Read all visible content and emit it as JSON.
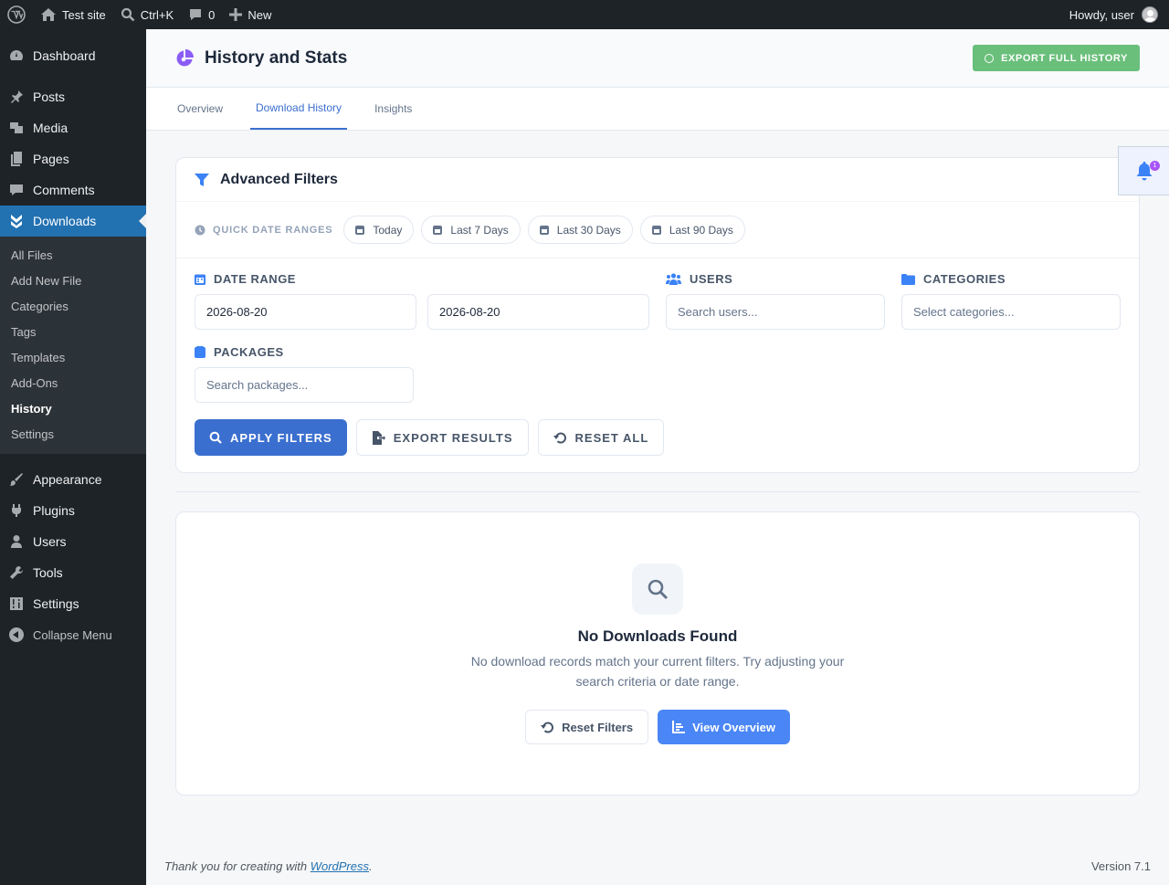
{
  "adminbar": {
    "site_name": "Test site",
    "search_shortcut": "Ctrl+K",
    "comments_count": "0",
    "new_label": "New",
    "greeting": "Howdy, user"
  },
  "sidebar": {
    "items_top": [
      {
        "label": "Dashboard",
        "icon": "dashboard-icon"
      }
    ],
    "items_mid": [
      {
        "label": "Posts",
        "icon": "pin-icon"
      },
      {
        "label": "Media",
        "icon": "media-icon"
      },
      {
        "label": "Pages",
        "icon": "pages-icon"
      },
      {
        "label": "Comments",
        "icon": "comment-icon"
      }
    ],
    "active": {
      "label": "Downloads",
      "icon": "downloads-icon"
    },
    "submenu": [
      "All Files",
      "Add New File",
      "Categories",
      "Tags",
      "Templates",
      "Add-Ons",
      "History",
      "Settings"
    ],
    "items_bottom": [
      {
        "label": "Appearance",
        "icon": "brush-icon"
      },
      {
        "label": "Plugins",
        "icon": "plugin-icon"
      },
      {
        "label": "Users",
        "icon": "user-icon"
      },
      {
        "label": "Tools",
        "icon": "wrench-icon"
      },
      {
        "label": "Settings",
        "icon": "settings-icon"
      }
    ],
    "collapse_label": "Collapse Menu"
  },
  "header": {
    "title": "History and Stats",
    "export_label": "EXPORT FULL HISTORY",
    "accent": "#8b5cf6"
  },
  "tabs": [
    "Overview",
    "Download History",
    "Insights"
  ],
  "filters": {
    "title": "Advanced Filters",
    "quick_label": "QUICK DATE RANGES",
    "quick_ranges": [
      "Today",
      "Last 7 Days",
      "Last 30 Days",
      "Last 90 Days"
    ],
    "date_range_label": "DATE RANGE",
    "date_from": "2026-08-20",
    "date_to": "2026-08-20",
    "users_label": "USERS",
    "users_placeholder": "Search users...",
    "categories_label": "CATEGORIES",
    "categories_placeholder": "Select categories...",
    "packages_label": "PACKAGES",
    "packages_placeholder": "Search packages...",
    "apply_label": "APPLY FILTERS",
    "export_label": "EXPORT RESULTS",
    "reset_label": "RESET ALL"
  },
  "empty": {
    "title": "No Downloads Found",
    "message": "No download records match your current filters. Try adjusting your search criteria or date range.",
    "reset_label": "Reset Filters",
    "overview_label": "View Overview"
  },
  "notification": {
    "count": "1"
  },
  "footer": {
    "thanks_prefix": "Thank you for creating with ",
    "link": "WordPress",
    "thanks_suffix": ".",
    "version": "Version 7.1"
  }
}
